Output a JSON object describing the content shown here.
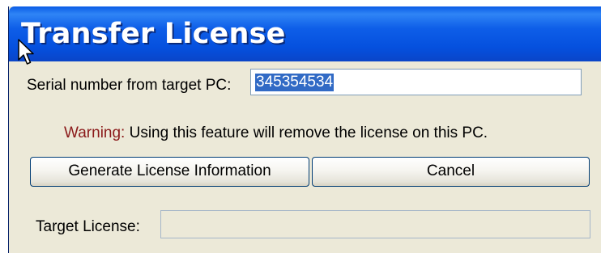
{
  "window": {
    "title": "Transfer License"
  },
  "form": {
    "serial_label": "Serial number from target PC:",
    "serial_value": "345354534",
    "warning_label": "Warning:",
    "warning_text": " Using this feature will remove the license on this PC.",
    "target_label": "Target License:",
    "target_value": ""
  },
  "buttons": {
    "generate_label": "Generate License Information",
    "cancel_label": "Cancel"
  },
  "colors": {
    "titlebar": "#0a5ce6",
    "warning": "#8b1a1a",
    "selection": "#316ac5",
    "dialog_bg": "#ece9d8"
  },
  "icons": {
    "cursor": "arrow-cursor-icon"
  }
}
